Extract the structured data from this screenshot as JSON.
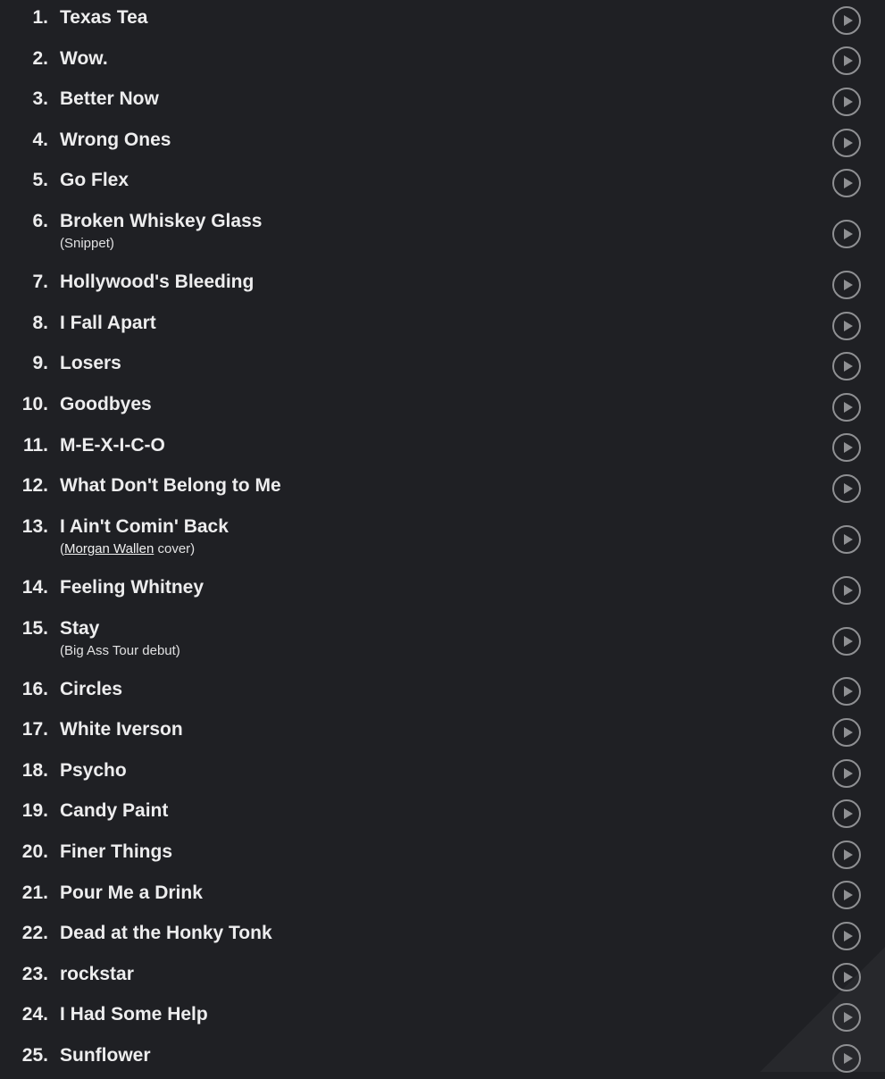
{
  "songs": [
    {
      "number": "1.",
      "title": "Texas Tea"
    },
    {
      "number": "2.",
      "title": "Wow."
    },
    {
      "number": "3.",
      "title": "Better Now"
    },
    {
      "number": "4.",
      "title": "Wrong Ones"
    },
    {
      "number": "5.",
      "title": "Go Flex"
    },
    {
      "number": "6.",
      "title": "Broken Whiskey Glass",
      "note": {
        "pre": "(Snippet)",
        "link": "",
        "post": ""
      }
    },
    {
      "number": "7.",
      "title": "Hollywood's Bleeding"
    },
    {
      "number": "8.",
      "title": "I Fall Apart"
    },
    {
      "number": "9.",
      "title": "Losers"
    },
    {
      "number": "10.",
      "title": "Goodbyes"
    },
    {
      "number": "11.",
      "title": "M-E-X-I-C-O"
    },
    {
      "number": "12.",
      "title": "What Don't Belong to Me"
    },
    {
      "number": "13.",
      "title": "I Ain't Comin' Back",
      "note": {
        "pre": "(",
        "link": "Morgan Wallen",
        "post": " cover)"
      }
    },
    {
      "number": "14.",
      "title": "Feeling Whitney"
    },
    {
      "number": "15.",
      "title": "Stay",
      "note": {
        "pre": "(Big Ass Tour debut)",
        "link": "",
        "post": ""
      }
    },
    {
      "number": "16.",
      "title": "Circles"
    },
    {
      "number": "17.",
      "title": "White Iverson"
    },
    {
      "number": "18.",
      "title": "Psycho"
    },
    {
      "number": "19.",
      "title": "Candy Paint"
    },
    {
      "number": "20.",
      "title": "Finer Things"
    },
    {
      "number": "21.",
      "title": "Pour Me a Drink"
    },
    {
      "number": "22.",
      "title": "Dead at the Honky Tonk"
    },
    {
      "number": "23.",
      "title": "rockstar"
    },
    {
      "number": "24.",
      "title": "I Had Some Help"
    },
    {
      "number": "25.",
      "title": "Sunflower"
    }
  ],
  "icons": {
    "play": "play-circle-icon"
  },
  "colors": {
    "background": "#1f2024",
    "text": "#ededee",
    "icon": "#8f9093"
  }
}
